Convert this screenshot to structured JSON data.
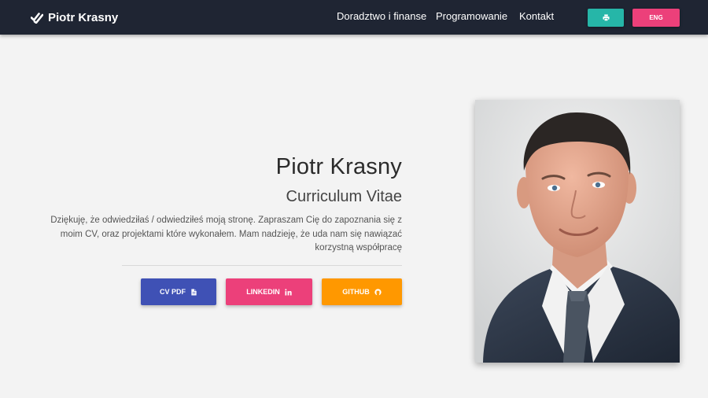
{
  "navbar": {
    "brand": "Piotr Krasny",
    "links": [
      "Doradztwo i finanse",
      "Programowanie",
      "Kontakt"
    ],
    "print_icon": "print-icon",
    "lang_label": "ENG",
    "colors": {
      "background": "#1f2533",
      "print": "#26b6a8",
      "lang": "#ec407a"
    }
  },
  "hero": {
    "name": "Piotr Krasny",
    "subtitle": "Curriculum Vitae",
    "intro": "Dziękuję, że odwiedziłaś / odwiedziłeś moją stronę. Zapraszam Cię do zapoznania się z moim CV, oraz projektami które wykonałem. Mam nadzieję, że uda nam się nawiązać korzystną współpracę",
    "buttons": {
      "cv": {
        "label": "CV PDF",
        "icon": "file-icon",
        "color": "#3f51b5"
      },
      "linkedin": {
        "label": "LINKEDIN",
        "icon": "linkedin-icon",
        "color": "#ec407a"
      },
      "github": {
        "label": "GITHUB",
        "icon": "github-icon",
        "color": "#ff9800"
      }
    }
  },
  "photo": {
    "icon": "portrait-photo"
  }
}
